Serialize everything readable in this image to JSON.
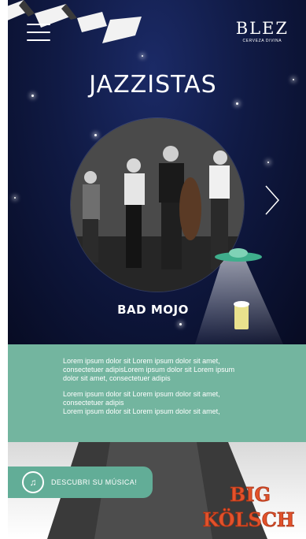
{
  "header": {
    "brand": "BLEZ",
    "brand_tagline": "CERVEZA DIVINA",
    "menu_icon": "hamburger-menu-icon"
  },
  "hero": {
    "title": "JAZZISTAS",
    "band_name": "BAD MOJO",
    "next_icon": "chevron-right-icon"
  },
  "description": {
    "paragraphs": [
      "Lorem ipsum dolor sit Lorem ipsum dolor sit amet, consectetuer adipisLorem ipsum dolor sit Lorem ipsum dolor sit amet, consectetuer adipis",
      "Lorem ipsum dolor sit Lorem ipsum dolor sit amet, consectetuer adipis",
      "Lorem ipsum dolor sit Lorem ipsum dolor sit amet,"
    ]
  },
  "cta": {
    "label": "DESCUBRI SU MÚSICA!",
    "icon": "music-note-icon"
  },
  "sponsor": {
    "line1": "BIG",
    "line2": "KÖLSCH"
  },
  "colors": {
    "sky_dark": "#070b22",
    "sky_light": "#1b2a66",
    "accent_green": "#73b59f",
    "cta_green": "#62ad97",
    "sponsor_red": "#e2522b"
  }
}
